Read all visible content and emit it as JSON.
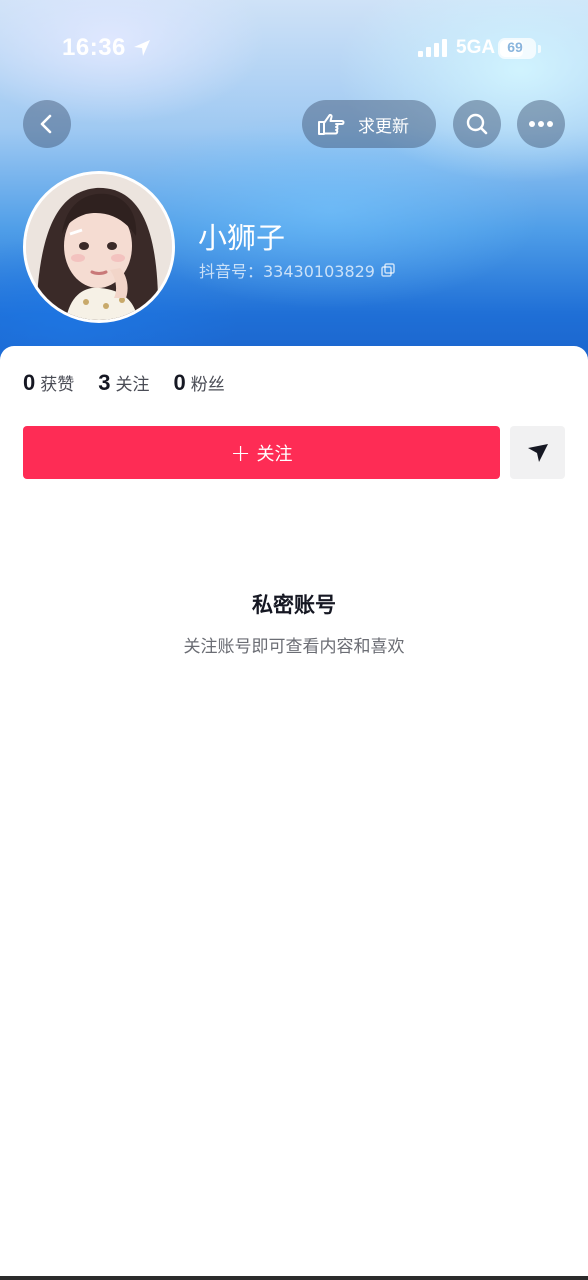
{
  "status_bar": {
    "time": "16:36",
    "network": "5GA",
    "battery": "69",
    "battery_level_percent": 69
  },
  "top_bar": {
    "back_icon": "chevron-left-icon",
    "update_request_label": "求更新",
    "update_icon": "pointing-hand-icon",
    "search_icon": "search-icon",
    "more_icon": "more-dots-icon"
  },
  "profile": {
    "nickname": "小狮子",
    "douyin_id": "抖音号：33430103829",
    "copy_icon": "copy-icon"
  },
  "stats": [
    {
      "value": "0",
      "label": "获赞"
    },
    {
      "value": "3",
      "label": "关注"
    },
    {
      "value": "0",
      "label": "粉丝"
    }
  ],
  "actions": {
    "follow_plus": "+",
    "follow_label": "关注",
    "share_icon": "send-icon"
  },
  "private_notice": {
    "title": "私密账号",
    "description": "关注账号即可查看内容和喜欢"
  },
  "colors": {
    "follow_button": "#fe2c55",
    "header_blue": "#1f6fd6"
  }
}
